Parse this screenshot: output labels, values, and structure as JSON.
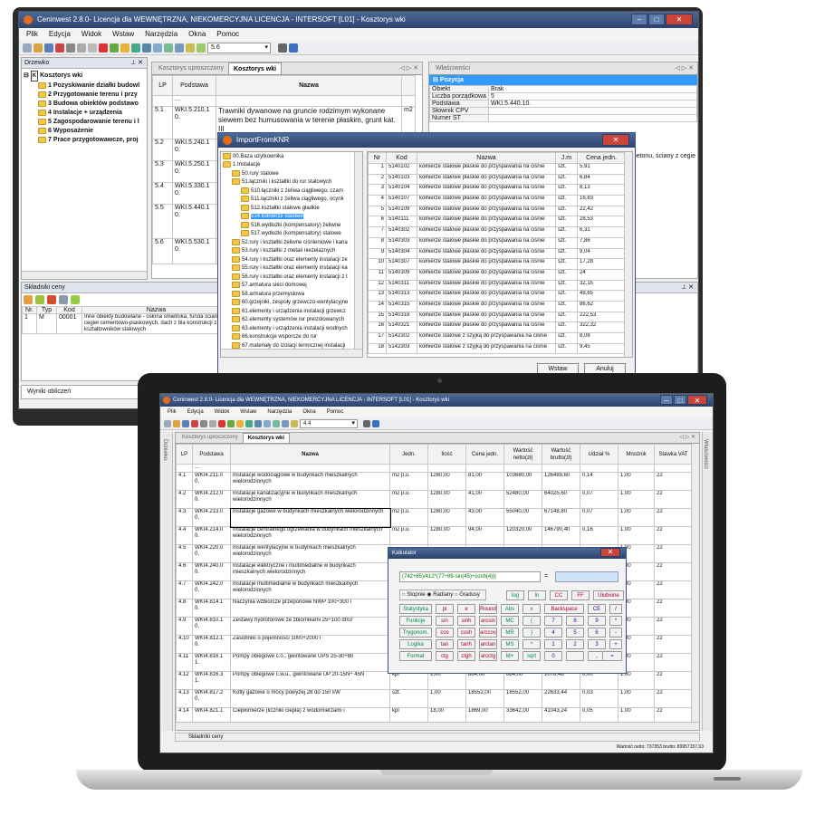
{
  "back": {
    "title": "Ceninwest 2.8.0- Licencja dla WEWNĘTRZNA, NIEKOMERCYJNA LICENCJA - INTERSOFT [L01] - Kosztorys wki",
    "menu": [
      "Plik",
      "Edycja",
      "Widok",
      "Wstaw",
      "Narzędzia",
      "Okna",
      "Pomoc"
    ],
    "combo_value": "5.6",
    "tree_header": "Drzewko",
    "tree_root": "Kosztorys wki",
    "tree_items": [
      "1 Pozyskiwanie działki budowl",
      "2 Przygotowanie terenu i przy",
      "3 Budowa obiektów podstawo",
      "4 Instalacje + urządzenia",
      "5 Zagospodarowanie terenu i l",
      "6 Wyposażenie",
      "7 Prace przygotowawcze, proj"
    ],
    "tabs": [
      "Kosztorys uproszczony",
      "Kosztorys wki"
    ],
    "cols": [
      "LP",
      "Podstawa",
      "Nazwa"
    ],
    "rows": [
      {
        "lp": "",
        "podstawa": "...",
        "nazwa": "",
        "jm": ""
      },
      {
        "lp": "5.1",
        "podstawa": "WKI.5.210.1\n0.",
        "nazwa": "Trawniki dywanowe na gruncie rodzimym wykonane siewem bez humusowania w terenie płaskim, grunt kat. III",
        "jm": "m2"
      },
      {
        "lp": "5.2",
        "podstawa": "WKI.5.240.1\n0.",
        "nazwa": "",
        "jm": ""
      },
      {
        "lp": "5.3",
        "podstawa": "WKI.5.250.1\n0.",
        "nazwa": "",
        "jm": ""
      },
      {
        "lp": "5.4",
        "podstawa": "WKI.5.330.1\n0.",
        "nazwa": "",
        "jm": ""
      },
      {
        "lp": "5.5",
        "podstawa": "WKI.5.440.1\n0.",
        "nazwa": "",
        "jm": ""
      },
      {
        "lp": "5.6",
        "podstawa": "WKI.5.530.1\n0.",
        "nazwa": "",
        "jm": ""
      }
    ],
    "props_header": "Właściwości",
    "props_group": "Pozycja",
    "props": [
      {
        "k": "Obiekt",
        "v": "Brak"
      },
      {
        "k": "Liczba porządkowa",
        "v": "5"
      },
      {
        "k": "Podstawa",
        "v": "WKI.5.440.10."
      },
      {
        "k": "Słownik CPV",
        "v": ""
      },
      {
        "k": "Numer ST",
        "v": ""
      }
    ],
    "props_overflow": "betonu, ściany z cegie",
    "skladniki_header": "Składniki ceny",
    "skl_cols": [
      "Nr.",
      "Typ",
      "Kod",
      "Nazwa"
    ],
    "skl_row": {
      "nr": "1",
      "typ": "M",
      "kod": "00001",
      "nazwa": "Inne obiekty budowlane - osłona śmietnika, funda ściany z cegieł cementowo-piaskowych, dach z bla konstrukcji z kształtowników stalowych"
    },
    "results": "Wyniki obliczeń"
  },
  "dialog": {
    "title": "ImportFromKNR",
    "tree": [
      {
        "t": "00.Baza użytkownika",
        "lvl": 0
      },
      {
        "t": "1.Instalacje",
        "lvl": 0
      },
      {
        "t": "50.rury stalowe",
        "lvl": 1
      },
      {
        "t": "51.łączniki i kształtki do rur stalowych",
        "lvl": 1
      },
      {
        "t": "510.łączniki z żeliwa ciągliwego, czarn",
        "lvl": 2
      },
      {
        "t": "511.łączniki z żeliwa ciągliwego, ocynk",
        "lvl": 2
      },
      {
        "t": "512.kształtki stalowe gładkie",
        "lvl": 2
      },
      {
        "t": "514.kołnierze stalowe",
        "lvl": 2,
        "sel": true
      },
      {
        "t": "516.wydłużki (kompensatory) żeliwne",
        "lvl": 2
      },
      {
        "t": "517.wydłużki (kompensatory) stalowe",
        "lvl": 2
      },
      {
        "t": "52.rury i kształtki żeliwne ciśnieniowe i kana",
        "lvl": 1
      },
      {
        "t": "53.rury i kształtki z metali nieżelaznych",
        "lvl": 1
      },
      {
        "t": "54.rury i kształtki oraz elementy instalacji ze",
        "lvl": 1
      },
      {
        "t": "55.rury i kształtki oraz elementy instalacji ka",
        "lvl": 1
      },
      {
        "t": "56.rury i kształtki oraz elementy instalacji z t",
        "lvl": 1
      },
      {
        "t": "57.armatura sieci domowej",
        "lvl": 1
      },
      {
        "t": "58.armatura przemysłowa",
        "lvl": 1
      },
      {
        "t": "60.grzejniki, zespoły grzewczo-wentylacyjne",
        "lvl": 1
      },
      {
        "t": "61.elementy i urządzenia instalacji grzewcz",
        "lvl": 1
      },
      {
        "t": "62.elementy systemów rur preizolowanych",
        "lvl": 1
      },
      {
        "t": "63.elementy i urządzenia instalacji wodnych",
        "lvl": 1
      },
      {
        "t": "66.konstrukcje wsporcze do rur",
        "lvl": 1
      },
      {
        "t": "67.materiały do izolacji termicznej instalacji",
        "lvl": 1
      }
    ],
    "cols": [
      "Nr",
      "Kod",
      "Nazwa",
      "J.m",
      "Cena jedn."
    ],
    "rows": [
      [
        "1",
        "5140102",
        "kołnierze stalowe płaskie do przyspawania na ciśnie",
        "szt.",
        "5,91"
      ],
      [
        "2",
        "5140103",
        "kołnierze stalowe płaskie do przyspawania na ciśnie",
        "szt.",
        "6,84"
      ],
      [
        "3",
        "5140104",
        "kołnierze stalowe płaskie do przyspawania na ciśnie",
        "szt.",
        "8,13"
      ],
      [
        "4",
        "5140107",
        "kołnierze stalowe płaskie do przyspawania na ciśnie",
        "szt.",
        "16,83"
      ],
      [
        "5",
        "5140109",
        "kołnierze stalowe płaskie do przyspawania na ciśnie",
        "szt.",
        "22,42"
      ],
      [
        "6",
        "5140111",
        "kołnierze stalowe płaskie do przyspawania na ciśnie",
        "szt.",
        "28,53"
      ],
      [
        "7",
        "5140302",
        "kołnierze stalowe płaskie do przyspawania na ciśnie",
        "szt.",
        "6,31"
      ],
      [
        "8",
        "5140303",
        "kołnierze stalowe płaskie do przyspawania na ciśnie",
        "szt.",
        "7,86"
      ],
      [
        "9",
        "5140304",
        "kołnierze stalowe płaskie do przyspawania na ciśnie",
        "szt.",
        "9,04"
      ],
      [
        "10",
        "5140307",
        "kołnierze stalowe płaskie do przyspawania na ciśnie",
        "szt.",
        "17,28"
      ],
      [
        "11",
        "5140309",
        "kołnierze stalowe płaskie do przyspawania na ciśnie",
        "szt.",
        "24"
      ],
      [
        "12",
        "5140311",
        "kołnierze stalowe płaskie do przyspawania na ciśnie",
        "szt.",
        "32,15"
      ],
      [
        "13",
        "5140313",
        "kołnierze stalowe płaskie do przyspawania na ciśnie",
        "szt.",
        "49,65"
      ],
      [
        "14",
        "5140315",
        "kołnierze stalowe płaskie do przyspawania na ciśnie",
        "szt.",
        "86,62"
      ],
      [
        "15",
        "5140318",
        "kołnierze stalowe płaskie do przyspawania na ciśnie",
        "szt.",
        "222,53"
      ],
      [
        "16",
        "5140321",
        "kołnierze stalowe płaskie do przyspawania na ciśnie",
        "szt.",
        "322,32"
      ],
      [
        "17",
        "5142302",
        "kołnierze stalowe z szyjką do przyspawania na ciśnie",
        "szt.",
        "8,08"
      ],
      [
        "18",
        "5142303",
        "kołnierze stalowe z szyjką do przyspawania na ciśnie",
        "szt.",
        "9,45"
      ]
    ],
    "insert_label": "Wstaw",
    "cancel_label": "Anuluj"
  },
  "front": {
    "title": "Ceninwest 2.8.0- Licencja dla WEWNĘTRZNA, NIEKOMERCYJNA LICENCJA - INTERSOFT [L01] - Kosztorys wki",
    "menu": [
      "Plik",
      "Edycja",
      "Widok",
      "Wstaw",
      "Narzędzia",
      "Okna",
      "Pomoc"
    ],
    "combo_value": "4.4",
    "tabs": [
      "Kosztorys uproszczony",
      "Kosztorys wki"
    ],
    "left_tab": "Drzewko",
    "right_tab": "Właściwości",
    "cols": [
      "LP",
      "Podstawa",
      "Nazwa",
      "Jedn.",
      "Ilość",
      "Cena jedn.",
      "Wartość netto(zł)",
      "Wartość brutto(zł)",
      "Udział %",
      "Mnożnik",
      "Stawka VAT"
    ],
    "rows": [
      [
        "",
        "...",
        "",
        "",
        "",
        "",
        "",
        "",
        "",
        "",
        ""
      ],
      [
        "4.1",
        "WKI4.211.0 0.",
        "Instalacje wodociągowe w budynkach mieszkalnych wielorodzinnych",
        "m2 p.u.",
        "1280,00",
        "81,00",
        "103680,00",
        "126489,60",
        "0,14",
        "1,00",
        "22"
      ],
      [
        "4.2",
        "WKI4.212.0 0.",
        "Instalacje kanalizacyjne w budynkach mieszkalnych wielorodzinnych",
        "m2 p.u.",
        "1280,00",
        "41,00",
        "52480,00",
        "64025,60",
        "0,07",
        "1,00",
        "22"
      ],
      [
        "4.3",
        "WKI4.213.0 0.",
        "Instalacje gazowe w budynkach mieszkalnych wielorodzinnych",
        "m2 p.u.",
        "1280,00",
        "43,00",
        "55040,00",
        "67148,80",
        "0,07",
        "1,00",
        "22"
      ],
      [
        "4.4",
        "WKI4.214.0 0.",
        "Instalacje centralnego ogrzewania w budynkach mieszkalnych wielorodzinnych",
        "m2 p.u.",
        "1280,00",
        "94,00",
        "120320,00",
        "146790,40",
        "0,16",
        "1,00",
        "22"
      ],
      [
        "4.5",
        "WKI4.220.0 0.",
        "Instalacje wentylacyjne w budynkach mieszkalnych wielorodzinnych",
        "",
        "",
        "",
        "",
        "",
        "",
        "1,00",
        "22"
      ],
      [
        "4.6",
        "WKI4.240.0 0.",
        "Instalacje elektryczne i multimedialne w budynkach mieszkalnych wielorodzinnych",
        "",
        "",
        "",
        "",
        "",
        "",
        "1,00",
        "22"
      ],
      [
        "4.7",
        "WKI4.242.0 0.",
        "Instalacje multimedialne w budynkach mieszkalnych wielorodzinnych",
        "",
        "",
        "",
        "",
        "",
        "",
        "1,00",
        "22"
      ],
      [
        "4.8",
        "WKI4.814.1 0.",
        "Naczynia wzbiorcze przeponowe NWP 100÷300 l",
        "",
        "",
        "",
        "",
        "",
        "",
        "1,00",
        "22"
      ],
      [
        "4.9",
        "WKI4.810.1 0.",
        "Zestawy hydroforowe ze zbiornikami 25÷100 dm3",
        "",
        "",
        "",
        "",
        "",
        "",
        "1,00",
        "22"
      ],
      [
        "4.10",
        "WKI4.812.1 0.",
        "Zasobniki o pojemności 1000÷2000 l",
        "",
        "",
        "",
        "",
        "",
        "",
        "1,00",
        "22"
      ],
      [
        "4.11",
        "WKI4.816.1 1.",
        "Pompy obiegowe c.o., gwintowane UPS 25-30÷80",
        "",
        "",
        "",
        "",
        "",
        "",
        "1,00",
        "22"
      ],
      [
        "4.12",
        "WKI4.816.3 1.",
        "Pompy obiegowe c.w.u., gwintowane UP 20-15N÷ 45N",
        "kpl",
        "1,00",
        "884,00",
        "884,00",
        "1078,48",
        "0,00",
        "1,00",
        "22"
      ],
      [
        "4.13",
        "WKI4.817.2 0.",
        "Kotły gazowe o mocy powyżej 28 do 150 kW",
        "szt.",
        "1,00",
        "18552,00",
        "18552,00",
        "22633,44",
        "0,03",
        "1,00",
        "22"
      ],
      [
        "4.14",
        "WKI4.821.1",
        "Ciepłomierze (liczniki ciepła) z wodomierzami i",
        "kpl",
        "18,00",
        "1869,00",
        "33642,00",
        "41043,24",
        "0,05",
        "1,00",
        "22"
      ]
    ],
    "bottom_tab": "Składniki ceny",
    "status": "Wartość netto: 737353 brutto: 89957157,63"
  },
  "calc": {
    "title": "Kalkulator",
    "expression": "(742÷85)/412*(77÷89-sin(45)÷cosh(4))|",
    "eq": "=",
    "result": "",
    "mode_labels": [
      "Stopnie",
      "Radiany",
      "Gradusy"
    ],
    "buttons": [
      [
        "Statystyka",
        "pi",
        "e",
        "Round",
        "Abs",
        "x",
        "Backspace",
        "CE",
        "/"
      ],
      [
        "Funkcje",
        "sin",
        "sinh",
        "arcsin",
        "MC",
        "(",
        "7",
        "8",
        "9",
        "*"
      ],
      [
        "Trygonom.",
        "cos",
        "cosh",
        "arccos",
        "MR",
        ")",
        "4",
        "5",
        "6",
        "-"
      ],
      [
        "Logika",
        "tan",
        "tanh",
        "arctan",
        "MS",
        "^",
        "1",
        "2",
        "3",
        "+"
      ],
      [
        "Format",
        "ctg",
        "ctgh",
        "arcctg",
        "M+",
        "sqrt",
        "0",
        "",
        ",",
        "="
      ]
    ],
    "top_buttons": [
      "log",
      "ln",
      "CC",
      "FF",
      "Ułubione"
    ]
  }
}
